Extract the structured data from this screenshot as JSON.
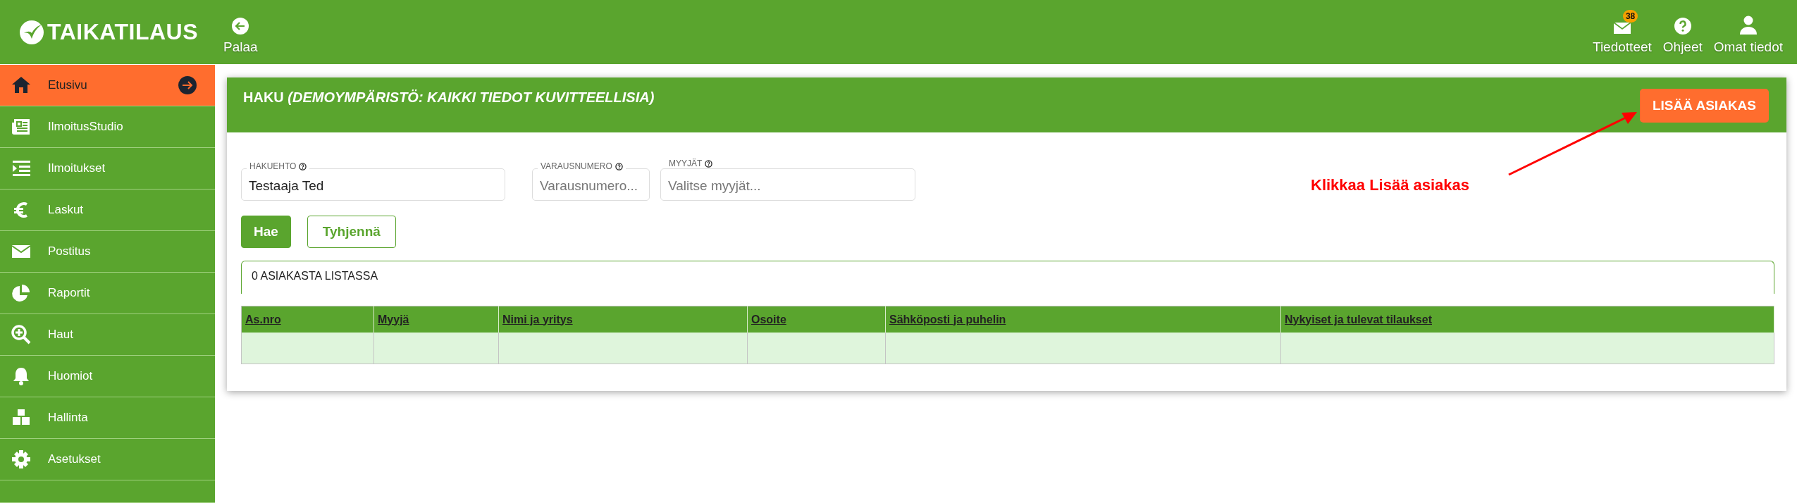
{
  "header": {
    "logo": "TAIKATILAUS",
    "back": "Palaa",
    "actions": [
      {
        "label": "Tiedotteet",
        "badge": "38"
      },
      {
        "label": "Ohjeet"
      },
      {
        "label": "Omat tiedot"
      }
    ]
  },
  "sidebar": {
    "items": [
      {
        "label": "Etusivu",
        "selected": true
      },
      {
        "label": "IlmoitusStudio",
        "selected": false
      },
      {
        "label": "Ilmoitukset",
        "selected": false
      },
      {
        "label": "Laskut",
        "selected": false
      },
      {
        "label": "Postitus",
        "selected": false
      },
      {
        "label": "Raportit",
        "selected": false
      },
      {
        "label": "Haut",
        "selected": false
      },
      {
        "label": "Huomiot",
        "selected": false
      },
      {
        "label": "Hallinta",
        "selected": false
      },
      {
        "label": "Asetukset",
        "selected": false
      }
    ]
  },
  "search": {
    "title": "HAKU *(DEMOYMPÄRISTÖ: KAIKKI TIEDOT KUVITTEELLISIA)*",
    "add_button": "LISÄÄ ASIAKAS",
    "fields": [
      {
        "label": "HAKUEHTO",
        "value": "Testaaja Ted"
      },
      {
        "label": "VARAUSNUMERO",
        "placeholder": "Varausnumero..."
      },
      {
        "label": "MYYJÄT",
        "placeholder": "Valitse myyjät..."
      }
    ],
    "buttons": [
      {
        "label": "Hae",
        "kind": "primary"
      },
      {
        "label": "Tyhjennä",
        "kind": "outline"
      }
    ],
    "result_count": "0 ASIAKASTA LISTASSA",
    "table": {
      "columns": [
        "As.nro",
        "Myyjä",
        "Nimi ja yritys",
        "Osoite",
        "Sähköposti ja puhelin",
        "Nykyiset ja tulevat tilaukset"
      ]
    }
  },
  "annotation": {
    "text": "Klikkaa Lisää asiakas"
  }
}
